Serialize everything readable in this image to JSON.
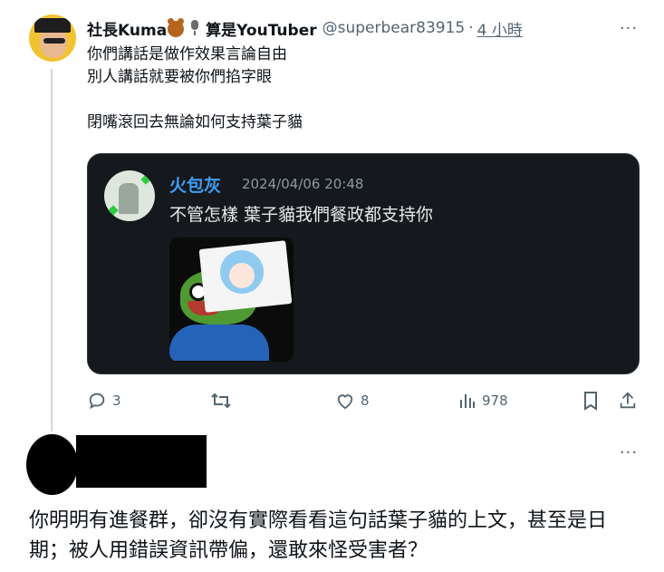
{
  "tweet": {
    "author_name": "社長Kuma",
    "author_suffix": "算是YouTuber",
    "handle": "@superbear83915",
    "separator": "·",
    "time": "4 小時",
    "more": "···",
    "lines": [
      "你們講話是做作效果言論自由",
      "別人講話就要被你們掐字眼",
      "",
      "閉嘴滾回去無論如何支持葉子貓"
    ]
  },
  "quoted": {
    "name": "火包灰",
    "date": "2024/04/06 20:48",
    "text": "不管怎樣 葉子貓我們餐政都支持你"
  },
  "actions": {
    "replies": "3",
    "likes": "8",
    "views": "978",
    "icons": [
      "reply-icon",
      "retweet-icon",
      "like-icon",
      "views-icon",
      "bookmark-icon",
      "share-icon"
    ]
  },
  "reply": {
    "more": "···",
    "text": "你明明有進餐群，卻沒有實際看看這句話葉子貓的上文，甚至是日期；被人用錯誤資訊帶偏，還敢來怪受害者？"
  },
  "colors": {
    "accent": "#1d9bf0",
    "quote_bg": "#15181c",
    "quote_name": "#3e9df3",
    "muted": "#536471"
  }
}
